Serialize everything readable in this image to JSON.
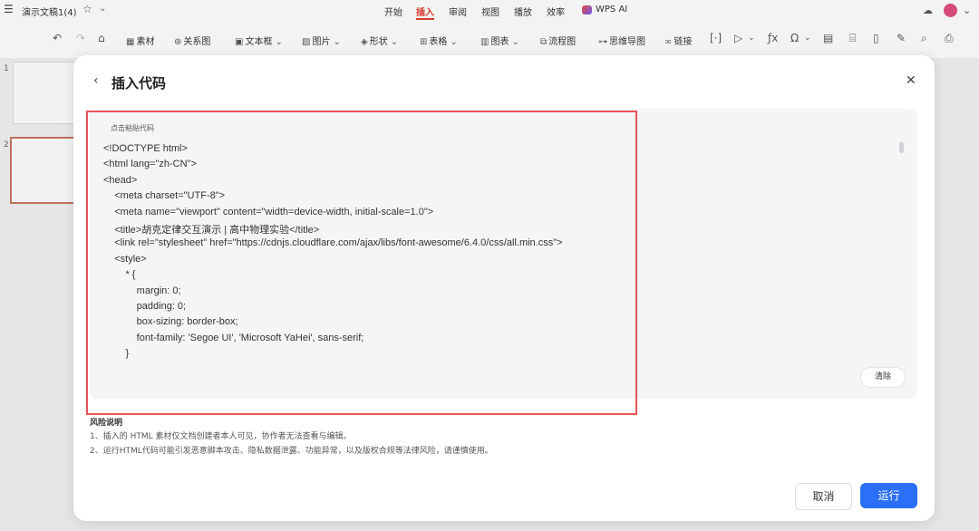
{
  "titlebar": {
    "menu_icon": "☰",
    "doc_title": "演示文稿1(4)",
    "star_icon": "☆",
    "chevron": "⌄",
    "tabs": [
      "开始",
      "插入",
      "审阅",
      "视图",
      "播放",
      "效率",
      "WPS AI"
    ],
    "active_tab": "插入",
    "accent": "#d23a2a"
  },
  "toolbar": {
    "undo": "↶",
    "redo": "↷",
    "tools": [
      "素材",
      "关系图",
      "文本框",
      "图片",
      "形状",
      "表格",
      "图表",
      "流程图",
      "思维导图",
      "链接"
    ]
  },
  "slides": [
    "1",
    "2"
  ],
  "dialog": {
    "back_icon": "‹",
    "title": "插入代码",
    "close_icon": "✕",
    "paste_hint": "点击粘贴代码",
    "code_lines": [
      "<!DOCTYPE html>",
      "<html lang=\"zh-CN\">",
      "<head>",
      "    <meta charset=\"UTF-8\">",
      "    <meta name=\"viewport\" content=\"width=device-width, initial-scale=1.0\">",
      "    <title>胡克定律交互演示 | 高中物理实验</title>",
      "    <link rel=\"stylesheet\" href=\"https://cdnjs.cloudflare.com/ajax/libs/font-awesome/6.4.0/css/all.min.css\">",
      "    <style>",
      "        * {",
      "            margin: 0;",
      "            padding: 0;",
      "            box-sizing: border-box;",
      "            font-family: 'Segoe UI', 'Microsoft YaHei', sans-serif;",
      "        }"
    ],
    "clear_label": "清除",
    "risk_title": "风险说明",
    "risk_lines": [
      "1、插入的 HTML 素材仅文档创建者本人可见，协作者无法查看与编辑。",
      "2、运行HTML代码可能引发恶意脚本攻击、隐私数据泄露、功能异常，以及版权合规等法律风险，请谨慎使用。"
    ],
    "cancel_label": "取消",
    "run_label": "运行",
    "run_color": "#2a6ff5",
    "highlight_color": "#e8545a"
  }
}
